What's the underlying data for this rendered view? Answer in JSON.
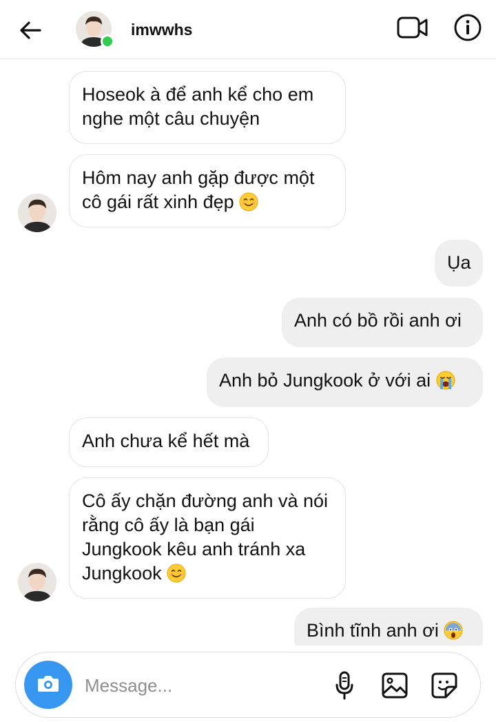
{
  "header": {
    "username": "imwwhs",
    "avatar_icon": "profile-avatar",
    "online": true,
    "online_color": "#2ecc4f"
  },
  "messages": [
    {
      "id": "m1",
      "side": "incoming",
      "text": "Hoseok à để anh kể cho em nghe một câu chuyện",
      "emoji": ""
    },
    {
      "id": "m2",
      "side": "incoming",
      "text": "Hôm nay anh gặp được một cô gái rất xinh đẹp",
      "emoji": "smiling-face-icon",
      "show_avatar": true
    },
    {
      "id": "m3",
      "side": "outgoing",
      "text": "Ụa",
      "emoji": ""
    },
    {
      "id": "m4",
      "side": "outgoing",
      "text": "Anh có bồ rồi anh ơi",
      "emoji": ""
    },
    {
      "id": "m5",
      "side": "outgoing",
      "text": "Anh bỏ Jungkook ở với ai",
      "emoji": "crying-face-icon"
    },
    {
      "id": "m6",
      "side": "incoming",
      "text": "Anh chưa kể hết mà",
      "emoji": ""
    },
    {
      "id": "m7",
      "side": "incoming",
      "text": "Cô ấy chặn đường anh và nói rằng cô ấy là bạn gái Jungkook kêu anh tránh xa Jungkook",
      "emoji": "smiling-face-icon",
      "show_avatar": true
    },
    {
      "id": "m8",
      "side": "outgoing",
      "text": "Bình tĩnh anh ơi",
      "emoji": "screaming-face-icon"
    }
  ],
  "composer": {
    "placeholder": "Message...",
    "camera_color": "#3797f0"
  },
  "colors": {
    "outgoing_bubble": "#efefef",
    "incoming_border": "#e3e3e3",
    "accent": "#3797f0"
  }
}
